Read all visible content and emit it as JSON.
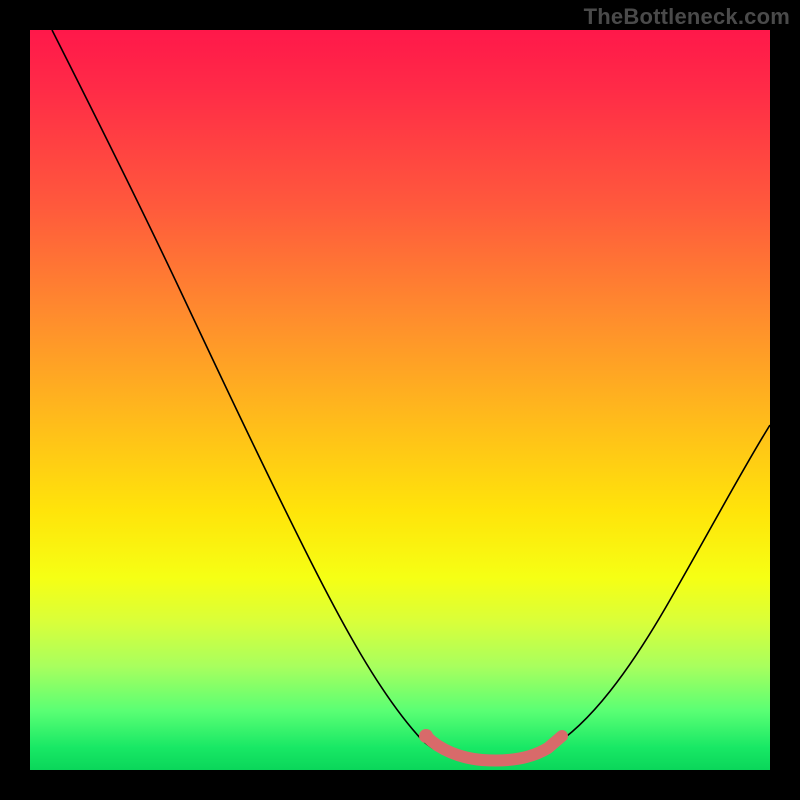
{
  "watermark": "TheBottleneck.com",
  "chart_data": {
    "type": "line",
    "title": "",
    "xlabel": "",
    "ylabel": "",
    "xlim": [
      0,
      100
    ],
    "ylim": [
      0,
      100
    ],
    "grid": false,
    "legend": false,
    "background_gradient_stops": [
      {
        "pos": 0,
        "color": "#ff184a"
      },
      {
        "pos": 24,
        "color": "#ff5a3c"
      },
      {
        "pos": 52,
        "color": "#ffb91c"
      },
      {
        "pos": 74,
        "color": "#f6ff14"
      },
      {
        "pos": 92,
        "color": "#5aff74"
      },
      {
        "pos": 100,
        "color": "#0ad65a"
      }
    ],
    "series": [
      {
        "name": "main-curve",
        "color": "#000000",
        "width": 1.4,
        "x": [
          3,
          8,
          14,
          20,
          26,
          32,
          38,
          44,
          50,
          53,
          56,
          60,
          64,
          68,
          70,
          74,
          78,
          82,
          86,
          90,
          94,
          98,
          100
        ],
        "y": [
          100,
          90,
          80,
          70,
          60,
          50,
          40,
          30,
          20,
          14,
          9,
          5,
          3,
          2,
          2,
          3,
          6,
          12,
          20,
          28,
          36,
          42,
          45
        ]
      },
      {
        "name": "highlight-band",
        "color": "#d86a6a",
        "width": 8,
        "x": [
          53,
          56,
          60,
          64,
          68,
          70,
          72
        ],
        "y": [
          6,
          4,
          3,
          2.5,
          2.5,
          3,
          4
        ]
      },
      {
        "name": "highlight-dot",
        "color": "#d86a6a",
        "type_hint": "scatter",
        "x": [
          53
        ],
        "y": [
          6
        ],
        "size": 10
      }
    ]
  }
}
